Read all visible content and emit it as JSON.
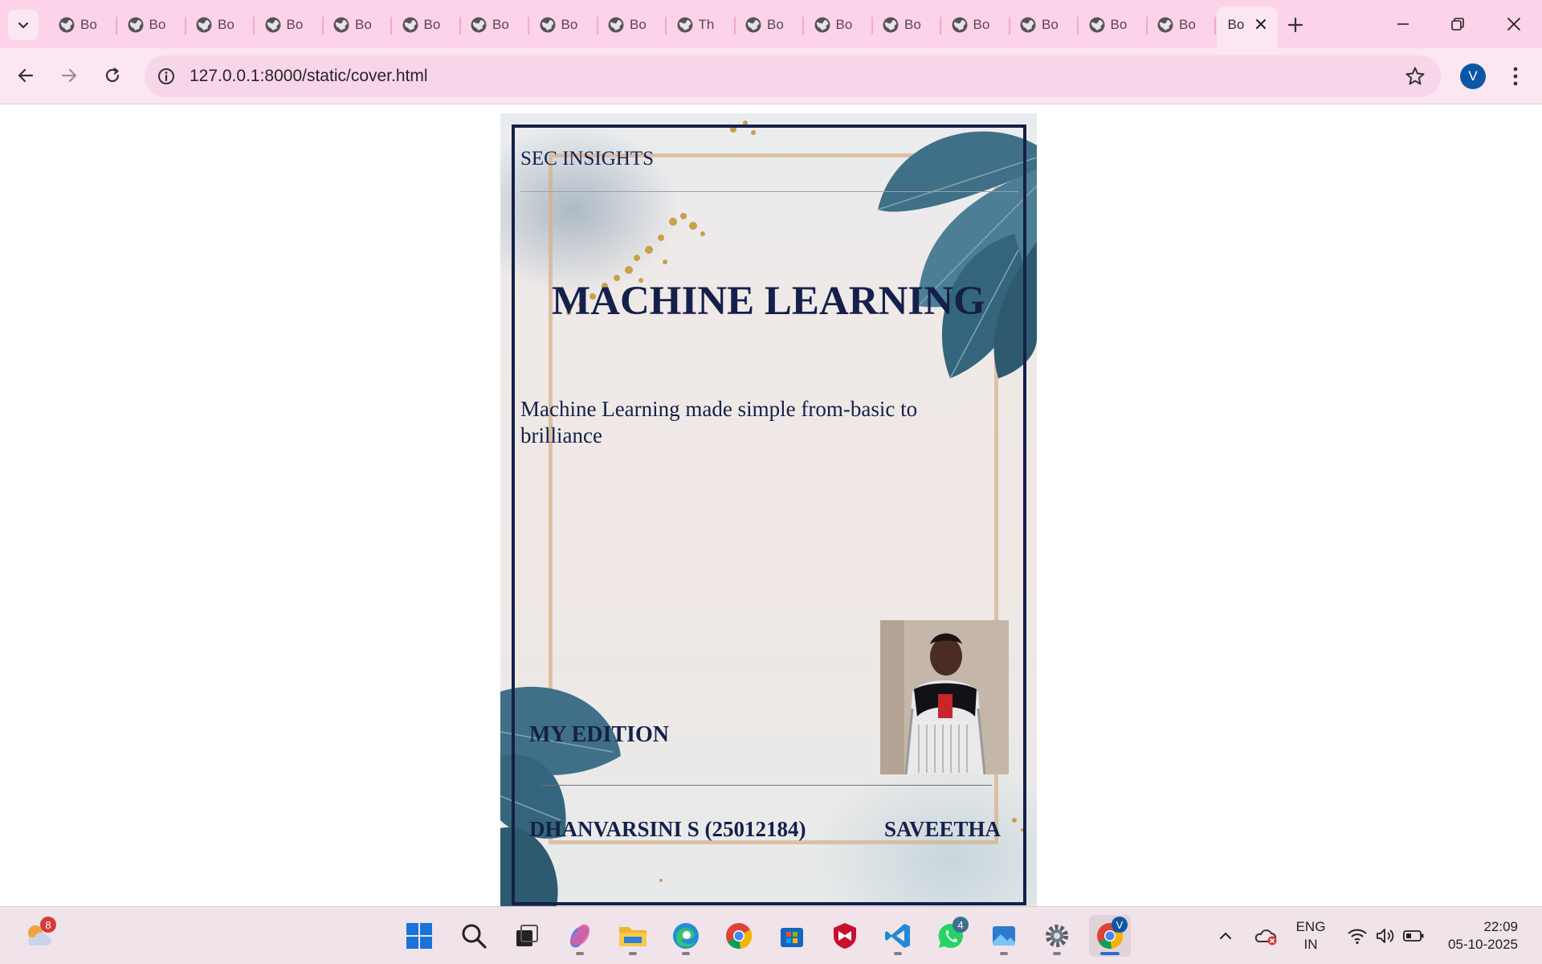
{
  "browser": {
    "tabs": [
      {
        "title": "Bo"
      },
      {
        "title": "Bo"
      },
      {
        "title": "Bo"
      },
      {
        "title": "Bo"
      },
      {
        "title": "Bo"
      },
      {
        "title": "Bo"
      },
      {
        "title": "Bo"
      },
      {
        "title": "Bo"
      },
      {
        "title": "Bo"
      },
      {
        "title": "Th"
      },
      {
        "title": "Bo"
      },
      {
        "title": "Bo"
      },
      {
        "title": "Bo"
      },
      {
        "title": "Bo"
      },
      {
        "title": "Bo"
      },
      {
        "title": "Bo"
      },
      {
        "title": "Bo"
      }
    ],
    "active_tab": {
      "title": "Bo"
    },
    "url": "127.0.0.1:8000/static/cover.html",
    "profile_initial": "V"
  },
  "cover": {
    "publisher": "SEC INSIGHTS",
    "title": "MACHINE LEARNING",
    "subtitle": "Machine Learning made simple from-basic to brilliance",
    "edition_label": "MY EDITION",
    "author": "DHANVARSINI S (25012184)",
    "college": "SAVEETHA"
  },
  "taskbar": {
    "weather_badge": "8",
    "whatsapp_badge": "4",
    "chrome_badge": "V",
    "language": {
      "line1": "ENG",
      "line2": "IN"
    },
    "time": "22:09",
    "date": "05-10-2025"
  },
  "colors": {
    "tab_strip": "#fcd3e8",
    "toolbar": "#fbe6f1",
    "cover_navy": "#14204a",
    "leaf_teal": "#3f7088",
    "taskbar": "#f0e3e9"
  }
}
